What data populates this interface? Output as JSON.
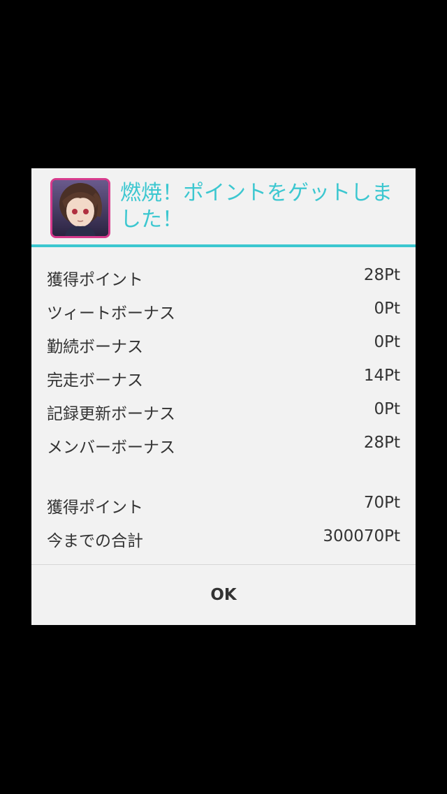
{
  "dialog": {
    "title": "燃焼！ポイントをゲットしました！",
    "app_icon": "anime-character-avatar",
    "accent_color": "#3cc7d0",
    "icon_border_color": "#d63a8c",
    "breakdown": [
      {
        "label": "獲得ポイント",
        "value": "28Pt"
      },
      {
        "label": "ツィートボーナス",
        "value": "0Pt"
      },
      {
        "label": "勤続ボーナス",
        "value": "0Pt"
      },
      {
        "label": "完走ボーナス",
        "value": "14Pt"
      },
      {
        "label": "記録更新ボーナス",
        "value": "0Pt"
      },
      {
        "label": "メンバーボーナス",
        "value": "28Pt"
      }
    ],
    "summary": [
      {
        "label": "獲得ポイント",
        "value": "70Pt"
      },
      {
        "label": "今までの合計",
        "value": "300070Pt"
      }
    ],
    "ok_label": "OK"
  }
}
